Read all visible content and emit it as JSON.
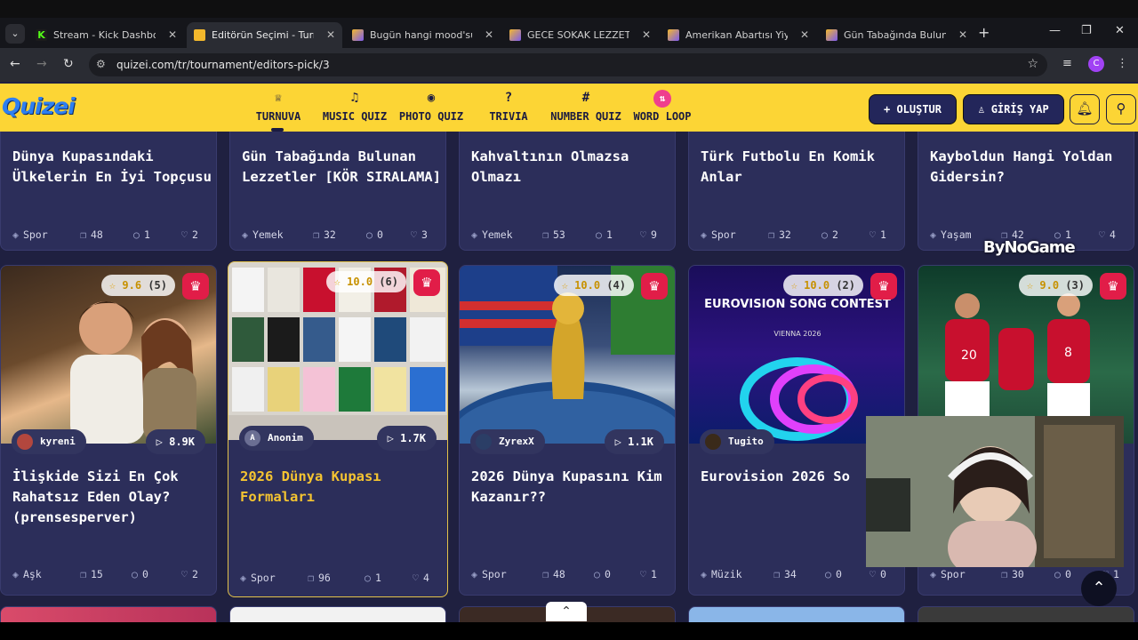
{
  "browser": {
    "tabs": [
      {
        "label": "Stream - Kick Dashboard",
        "fav_color": "#53fc18"
      },
      {
        "label": "Editörün Seçimi - Turnuva",
        "fav_color": "#f3b82c",
        "active": true
      },
      {
        "label": "Bugün hangi mood'sun? -",
        "fav_color": "#7c5cf0"
      },
      {
        "label": "GECE SOKAK LEZZETLERİ",
        "fav_color": "#7c5cf0"
      },
      {
        "label": "Amerikan Abartısı Yiyecek",
        "fav_color": "#7c5cf0"
      },
      {
        "label": "Gün Tabağında Bulunan Le",
        "fav_color": "#7c5cf0"
      }
    ],
    "url": "quizei.com/tr/tournament/editors-pick/3",
    "profile_initial": "C"
  },
  "header": {
    "logo": "Quizei",
    "nav": [
      {
        "label": "TURNUVA",
        "icon": "trophy-icon",
        "glyph": "♕"
      },
      {
        "label": "MUSIC QUIZ",
        "icon": "music-note-icon",
        "glyph": "♫"
      },
      {
        "label": "PHOTO QUIZ",
        "icon": "camera-icon",
        "glyph": "◉"
      },
      {
        "label": "TRIVIA",
        "icon": "question-bubble-icon",
        "glyph": "?"
      },
      {
        "label": "NUMBER QUIZ",
        "icon": "hash-icon",
        "glyph": "#"
      },
      {
        "label": "WORD LOOP",
        "icon": "word-loop-icon",
        "glyph": "⇅"
      }
    ],
    "create_label": "OLUŞTUR",
    "login_label": "GİRİŞ YAP"
  },
  "cards_row1": [
    {
      "title": "Dünya Kupasındaki Ülkelerin En İyi Topçusu",
      "category": "Spor",
      "items": "48",
      "comments": "1",
      "likes": "2"
    },
    {
      "title": "Gün Tabağında Bulunan Lezzetler [KÖR SIRALAMA]",
      "category": "Yemek",
      "items": "32",
      "comments": "0",
      "likes": "3"
    },
    {
      "title": "Kahvaltının Olmazsa Olmazı",
      "category": "Yemek",
      "items": "53",
      "comments": "1",
      "likes": "9"
    },
    {
      "title": "Türk Futbolu En Komik Anlar",
      "category": "Spor",
      "items": "32",
      "comments": "2",
      "likes": "1"
    },
    {
      "title": "Kayboldun Hangi Yoldan Gidersin?",
      "category": "Yaşam",
      "items": "42",
      "comments": "1",
      "likes": "4"
    }
  ],
  "cards_row2": [
    {
      "title": "İlişkide Sizi En Çok Rahatsız Eden Olay? (prensesperver)",
      "rating": "9.6",
      "votes": "(5)",
      "author": "kyreni",
      "plays": "8.9K",
      "category": "Aşk",
      "items": "15",
      "comments": "0",
      "likes": "2"
    },
    {
      "title": "2026 Dünya Kupası Formaları",
      "rating": "10.0",
      "votes": "(6)",
      "author": "Anonim",
      "plays": "1.7K",
      "category": "Spor",
      "items": "96",
      "comments": "1",
      "likes": "4"
    },
    {
      "title": "2026 Dünya Kupasını Kim Kazanır??",
      "rating": "10.0",
      "votes": "(4)",
      "author": "ZyrexX",
      "plays": "1.1K",
      "category": "Spor",
      "items": "48",
      "comments": "0",
      "likes": "1"
    },
    {
      "title": "Eurovision 2026 So",
      "rating": "10.0",
      "votes": "(2)",
      "author": "Tugito",
      "plays": "",
      "category": "Müzik",
      "items": "34",
      "comments": "0",
      "likes": "0"
    },
    {
      "title": "",
      "rating": "9.0",
      "votes": "(3)",
      "author": "",
      "plays": "",
      "category": "Spor",
      "items": "30",
      "comments": "0",
      "likes": "1"
    }
  ],
  "thumbs": {
    "eurovision_text": "EUROVISION SONG CONTEST",
    "eurovision_sub": "VIENNA 2026",
    "jersey_numbers": [
      "20",
      "8"
    ]
  },
  "overlay": {
    "brand": "ByNoGame"
  }
}
